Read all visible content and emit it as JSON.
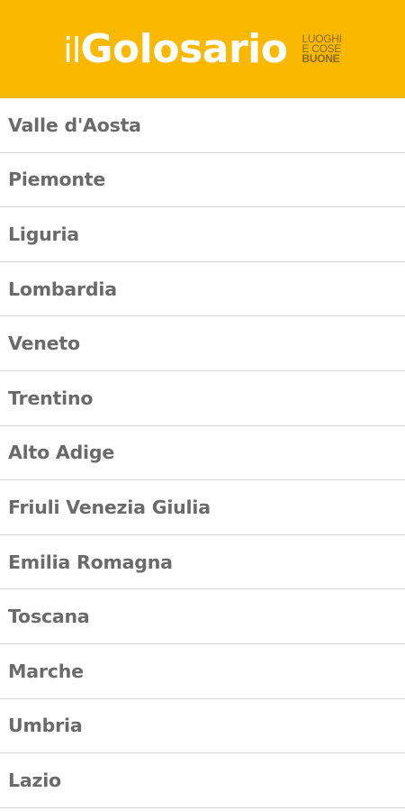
{
  "header": {
    "logo_il": "il",
    "logo_main": "Golosario",
    "tagline_1": "LUOGHI",
    "tagline_2": "E COSE",
    "tagline_3": "BUONE",
    "background_color": "#fbb800"
  },
  "regions": [
    {
      "label": "Valle d'Aosta"
    },
    {
      "label": "Piemonte"
    },
    {
      "label": "Liguria"
    },
    {
      "label": "Lombardia"
    },
    {
      "label": "Veneto"
    },
    {
      "label": "Trentino"
    },
    {
      "label": "Alto Adige"
    },
    {
      "label": "Friuli Venezia Giulia"
    },
    {
      "label": "Emilia Romagna"
    },
    {
      "label": "Toscana"
    },
    {
      "label": "Marche"
    },
    {
      "label": "Umbria"
    },
    {
      "label": "Lazio"
    }
  ]
}
